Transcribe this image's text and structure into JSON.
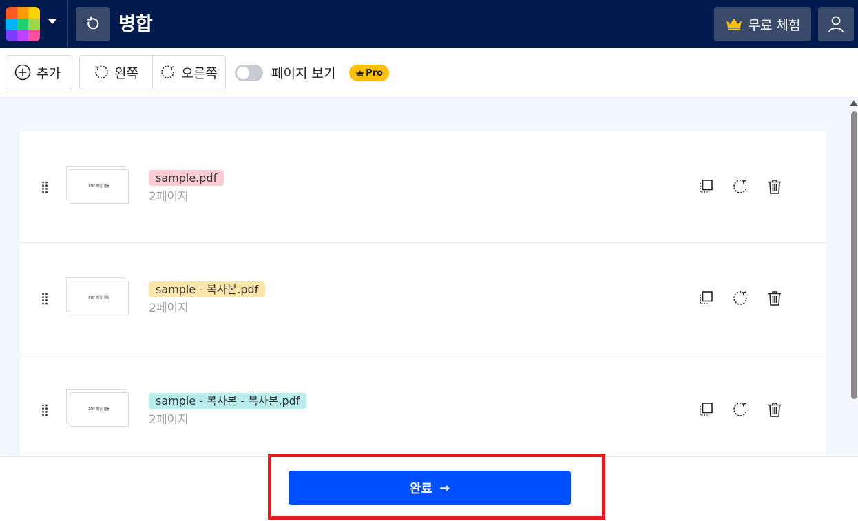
{
  "header": {
    "title": "병합",
    "trial_label": "무료 체험",
    "logo_colors": [
      "#ff5a1f",
      "#ff9a00",
      "#ffd200",
      "#00b4ff",
      "#1fd26b",
      "#9bd94a",
      "#7b3cff",
      "#c040ff",
      "#ff4fa0"
    ]
  },
  "toolbar": {
    "add_label": "추가",
    "rotate_left_label": "왼쪽",
    "rotate_right_label": "오른쪽",
    "page_view_label": "페이지 보기",
    "pro_label": "Pro"
  },
  "files": [
    {
      "name": "sample.pdf",
      "pages": "2페이지",
      "tag_color": "#f9cdd3",
      "thumb_text": "PDF 파일 샘플"
    },
    {
      "name": "sample - 복사본.pdf",
      "pages": "2페이지",
      "tag_color": "#fbe5a8",
      "thumb_text": "PDF 파일 샘플"
    },
    {
      "name": "sample - 복사본 - 복사본.pdf",
      "pages": "2페이지",
      "tag_color": "#b9ecec",
      "thumb_text": "PDF 파일 샘플"
    }
  ],
  "footer": {
    "done_label": "완료",
    "done_arrow": "→"
  },
  "icons": {
    "logo": "app-logo-icon",
    "back": "undo-icon",
    "crown": "crown-icon",
    "user": "user-icon",
    "add": "plus-circle-icon",
    "rotate_left": "rotate-left-icon",
    "rotate_right": "rotate-right-icon",
    "drag": "drag-handle-icon",
    "duplicate": "duplicate-icon",
    "rotate": "rotate-icon",
    "delete": "trash-icon"
  }
}
